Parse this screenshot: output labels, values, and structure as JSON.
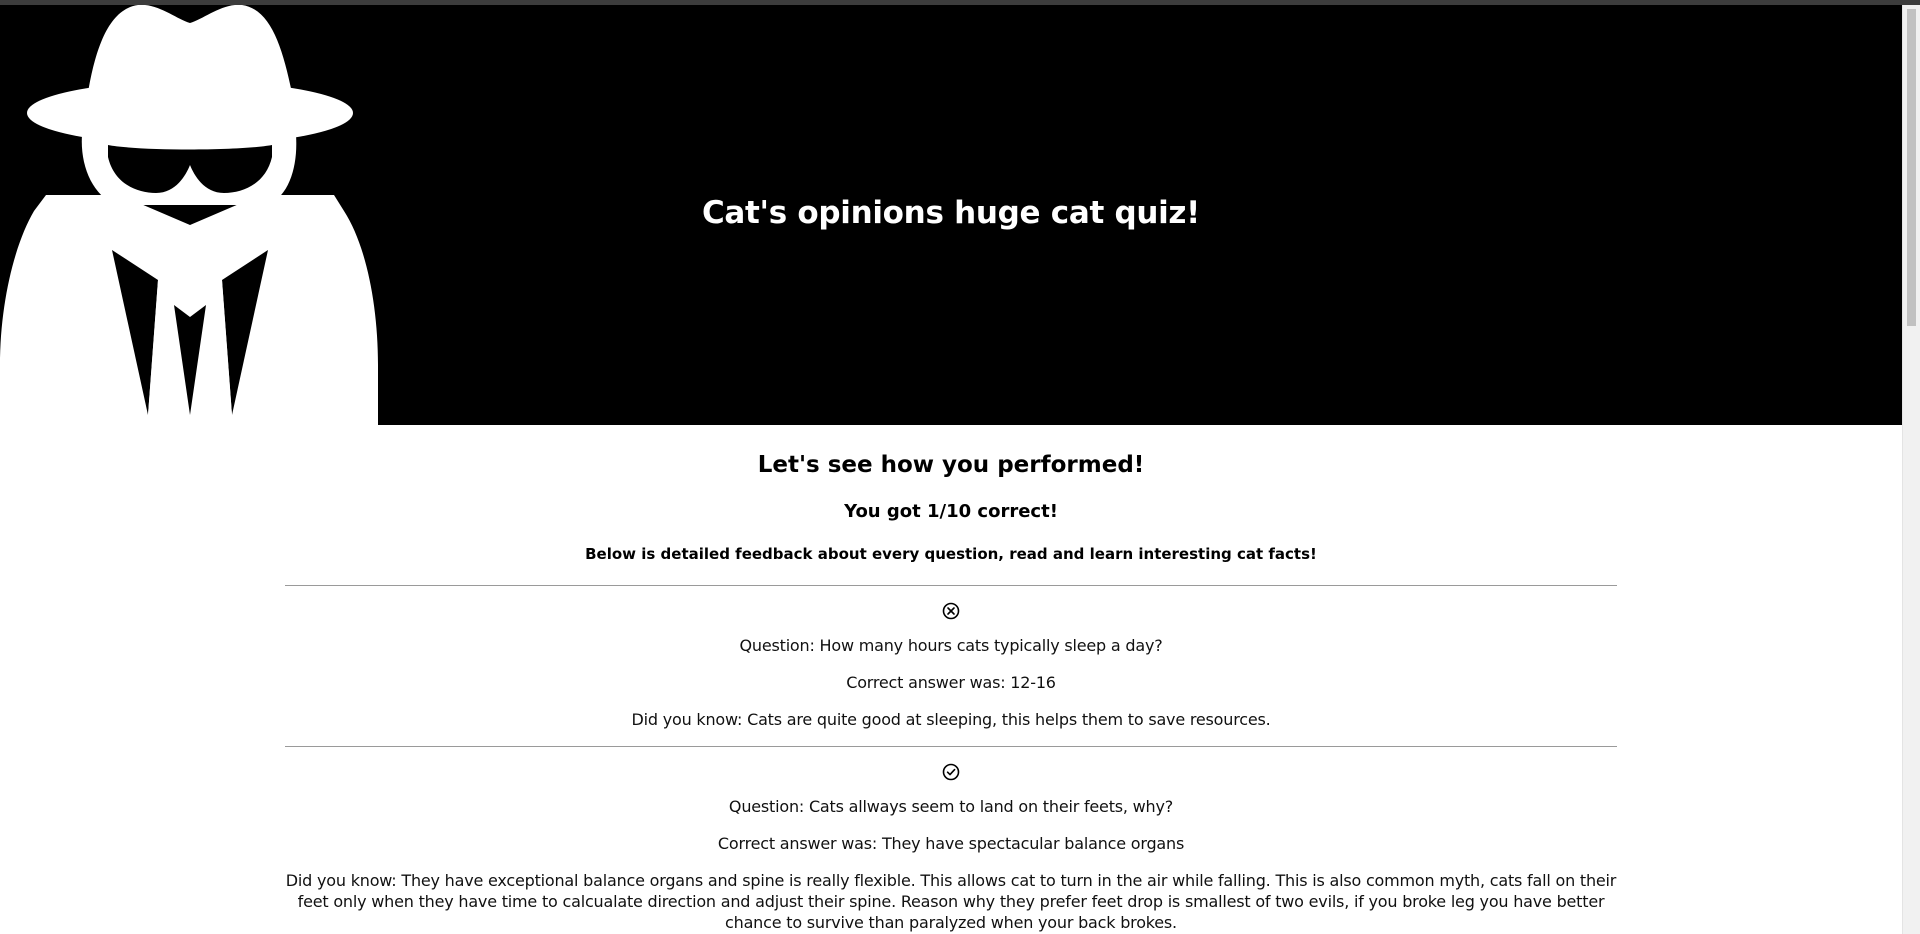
{
  "header": {
    "title": "Cat's opinions huge cat quiz!",
    "logo_icon": "spy-incognito-icon"
  },
  "results": {
    "heading": "Let's see how you performed!",
    "score_text": "You got 1/10 correct!",
    "intro_text": "Below is detailed feedback about every question, read and learn interesting cat facts!"
  },
  "feedback": [
    {
      "status": "incorrect",
      "icon": "circle-x-icon",
      "question": "Question: How many hours cats typically sleep a day?",
      "answer": "Correct answer was: 12-16",
      "fact": "Did you know: Cats are quite good at sleeping, this helps them to save resources."
    },
    {
      "status": "correct",
      "icon": "circle-check-icon",
      "question": "Question: Cats allways seem to land on their feets, why?",
      "answer": "Correct answer was: They have spectacular balance organs",
      "fact": "Did you know: They have exceptional balance organs and spine is really flexible. This allows cat to turn in the air while falling. This is also common myth, cats fall on their feet only when they have time to calcualate direction and adjust their spine. Reason why they prefer feet drop is smallest of two evils, if you broke leg you have better chance to survive than paralyzed when your back brokes."
    }
  ],
  "colors": {
    "header_bg": "#000000",
    "header_text": "#ffffff",
    "divider": "#9a9a9a"
  }
}
